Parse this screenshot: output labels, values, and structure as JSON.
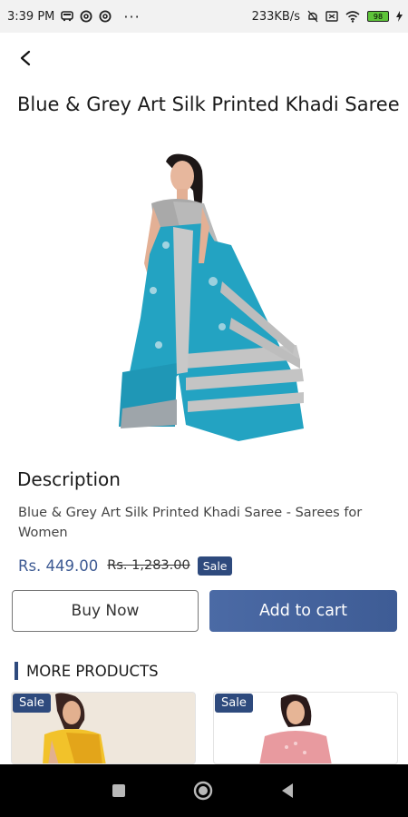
{
  "status_bar": {
    "time": "3:39 PM",
    "dots": "···",
    "speed": "233KB/s",
    "battery": "98",
    "icons": [
      "bus-icon",
      "at-icon",
      "at-icon",
      "mute-icon",
      "sim-icon",
      "wifi-icon",
      "battery-icon",
      "charging-icon"
    ]
  },
  "header": {
    "back_icon": "back-arrow-icon"
  },
  "product": {
    "title": "Blue & Grey Art Silk Printed Khadi Saree",
    "description_heading": "Description",
    "description": "Blue & Grey Art Silk Printed Khadi Saree - Sarees for Women",
    "price": "Rs. 449.00",
    "mrp": "Rs. 1,283.00",
    "badge": "Sale",
    "colors": {
      "saree_teal": "#23a3c2",
      "saree_grey": "#b9b9b9"
    }
  },
  "actions": {
    "buy_now": "Buy Now",
    "add_to_cart": "Add to cart"
  },
  "more_products": {
    "heading": "MORE PRODUCTS",
    "items": [
      {
        "badge": "Sale"
      },
      {
        "badge": "Sale"
      }
    ]
  },
  "nav": {
    "icons": [
      "recents-icon",
      "home-icon",
      "back-triangle-icon"
    ]
  },
  "colors": {
    "accent": "#2e4a7d",
    "price": "#3d5a93",
    "button": "#4b6aa5"
  }
}
